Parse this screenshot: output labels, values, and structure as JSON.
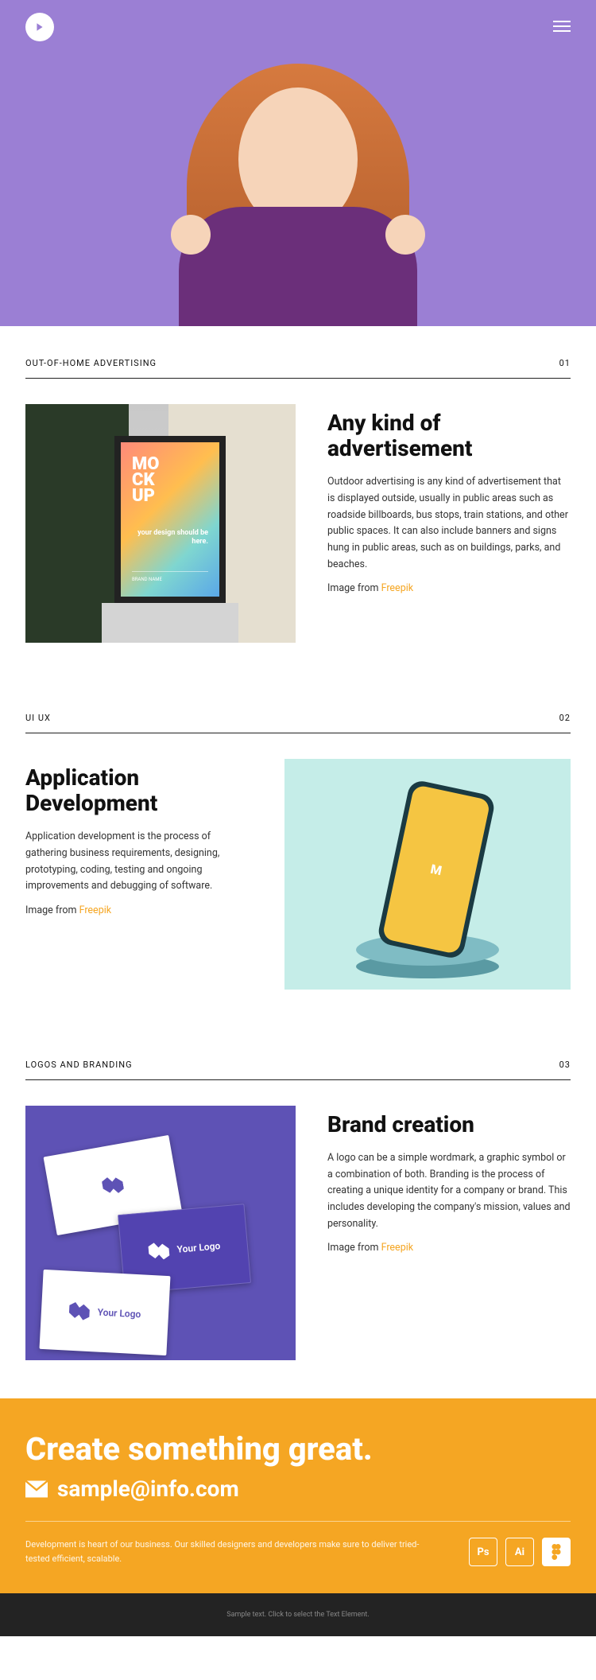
{
  "sections": [
    {
      "eyebrow": "OUT-OF-HOME ADVERTISING",
      "num": "01",
      "title": "Any kind of advertisement",
      "body": "Outdoor advertising is any kind of advertisement that is displayed outside, usually in public areas such as roadside billboards, bus stops, train stations, and other public spaces. It can also include banners and signs hung in public areas, such as on buildings, parks, and beaches.",
      "credit_prefix": "Image from ",
      "credit_link": "Freepik"
    },
    {
      "eyebrow": "UI UX",
      "num": "02",
      "title": "Application Development",
      "body": "Application development is the process of gathering business requirements, designing, prototyping, coding, testing and ongoing improvements and debugging of software.",
      "credit_prefix": "Image from ",
      "credit_link": "Freepik"
    },
    {
      "eyebrow": "LOGOS AND BRANDING",
      "num": "03",
      "title": "Brand creation",
      "body": "A logo can be a simple wordmark, a graphic symbol or a combination of both. Branding is the process of creating a unique identity for a company or brand. This includes developing the company's mission, values and personality.",
      "credit_prefix": "Image from ",
      "credit_link": "Freepik"
    }
  ],
  "mockup": {
    "line1": "MO",
    "line2": "CK",
    "line3": "UP",
    "tag": "your design should be here.",
    "brand": "BRAND NAME"
  },
  "card_label": "Your Logo",
  "cta": {
    "headline": "Create something great.",
    "email": "sample@info.com",
    "body": "Development is heart of our business. Our skilled designers and developers make sure to deliver tried-tested efficient, scalable.",
    "tools": [
      "Ps",
      "Ai"
    ]
  },
  "footer": "Sample text. Click to select the Text Element."
}
